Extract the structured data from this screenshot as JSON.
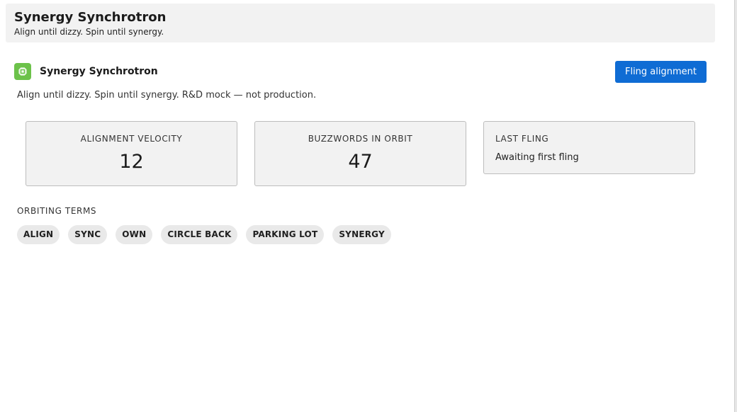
{
  "header": {
    "title": "Synergy Synchrotron",
    "subtitle": "Align until dizzy. Spin until synergy."
  },
  "widget": {
    "icon": "chip-icon",
    "title": "Synergy Synchrotron",
    "action_label": "Fling alignment",
    "description": "Align until dizzy. Spin until synergy. R&D mock — not production."
  },
  "stats": {
    "velocity": {
      "label": "ALIGNMENT VELOCITY",
      "value": "12"
    },
    "orbit": {
      "label": "BUZZWORDS IN ORBIT",
      "value": "47"
    },
    "last_fling": {
      "label": "LAST FLING",
      "status": "Awaiting first fling"
    }
  },
  "terms": {
    "label": "ORBITING TERMS",
    "items": [
      "ALIGN",
      "SYNC",
      "OWN",
      "CIRCLE BACK",
      "PARKING LOT",
      "SYNERGY"
    ]
  },
  "colors": {
    "accent": "#0f6cd4",
    "icon_bg": "#6cc24a",
    "card_bg": "#f2f2f2"
  }
}
